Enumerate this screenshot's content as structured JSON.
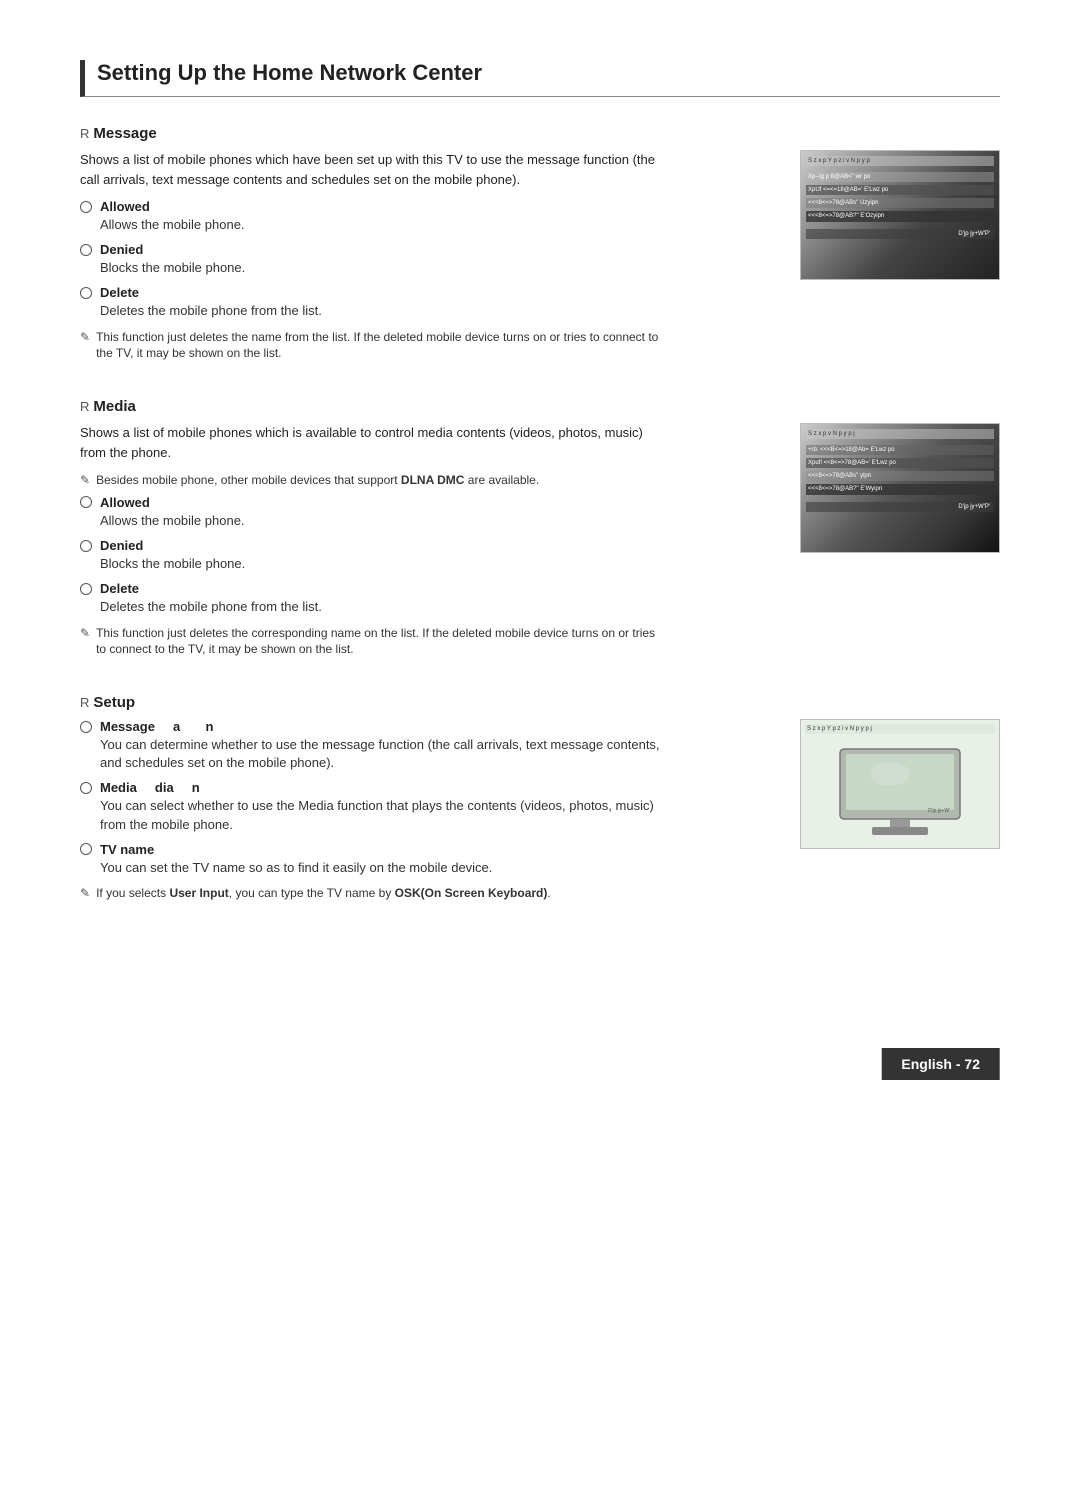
{
  "page": {
    "title": "Setting Up the Home Network Center",
    "footer_label": "English - 72"
  },
  "sections": [
    {
      "id": "message",
      "r_marker": "R",
      "title": "Message",
      "description": "Shows a list of mobile phones which have been set up with this TV to use the message function (the call arrivals, text message contents and schedules set on the mobile phone).",
      "options": [
        {
          "label": "Allowed",
          "description": "Allows the mobile phone."
        },
        {
          "label": "Denied",
          "description": "Blocks the mobile phone."
        },
        {
          "label": "Delete",
          "description": "Deletes the mobile phone from the list."
        }
      ],
      "note": "This function just deletes the name from the list. If the deleted mobile device turns on or tries to connect to the TV, it may be shown on the list."
    },
    {
      "id": "media",
      "r_marker": "R",
      "title": "Media",
      "description": "Shows a list of mobile phones which is available to control media contents (videos, photos, music) from the phone.",
      "note_inline": "Besides mobile phone, other mobile devices that support DLNA DMC are available.",
      "options": [
        {
          "label": "Allowed",
          "description": "Allows the mobile phone."
        },
        {
          "label": "Denied",
          "description": "Blocks the mobile phone."
        },
        {
          "label": "Delete",
          "description": "Deletes the mobile phone from the list."
        }
      ],
      "note": "This function just deletes the corresponding name on the list. If the deleted mobile device turns on or tries to connect to the TV, it may be shown on the list."
    },
    {
      "id": "setup",
      "r_marker": "R",
      "title": "Setup",
      "options": [
        {
          "label": "Message",
          "label_prefix": "",
          "description": "You can determine whether to use the message function (the call arrivals, text message contents, and schedules set on the mobile phone)."
        },
        {
          "label": "Media",
          "label_prefix": "",
          "description": "You can select whether to use the Media function that plays the contents (videos, photos, music) from the mobile phone."
        },
        {
          "label": "TV name",
          "description": "You can set the TV name so as to find it easily on the mobile device."
        }
      ],
      "note": "If you selects User Input, you can type the TV name by OSK(On Screen Keyboard)."
    }
  ],
  "screen_lines_msg": [
    "S z x p Y p  z i v N p y  p",
    "Xp--lg p        8@AB<''",
    "XpUf   <=<=18@AB='    E'Lwz po",
    "      <<<8<=>78@ABs''       Uzyipn",
    "      <<<8<=>78@AB?''    E'Ozyipn",
    "                   D'jp jy+W'P'"
  ],
  "screen_lines_media": [
    "S z x p       v N p y  p j",
    "  +rb:  <<<B<=>18@Ab=    E'Lwz po",
    "Xpuf!   <<8<=>78@AB='   E'Lwz po",
    "        <<<8<=>78@ABs''        ylpn",
    "        <<<8<=>78@AB?''   E'Wyipn",
    "                   D'jp jy+W'P'"
  ],
  "screen_lines_setup": [
    "S z x p Y p  z i v N p y  p j"
  ]
}
